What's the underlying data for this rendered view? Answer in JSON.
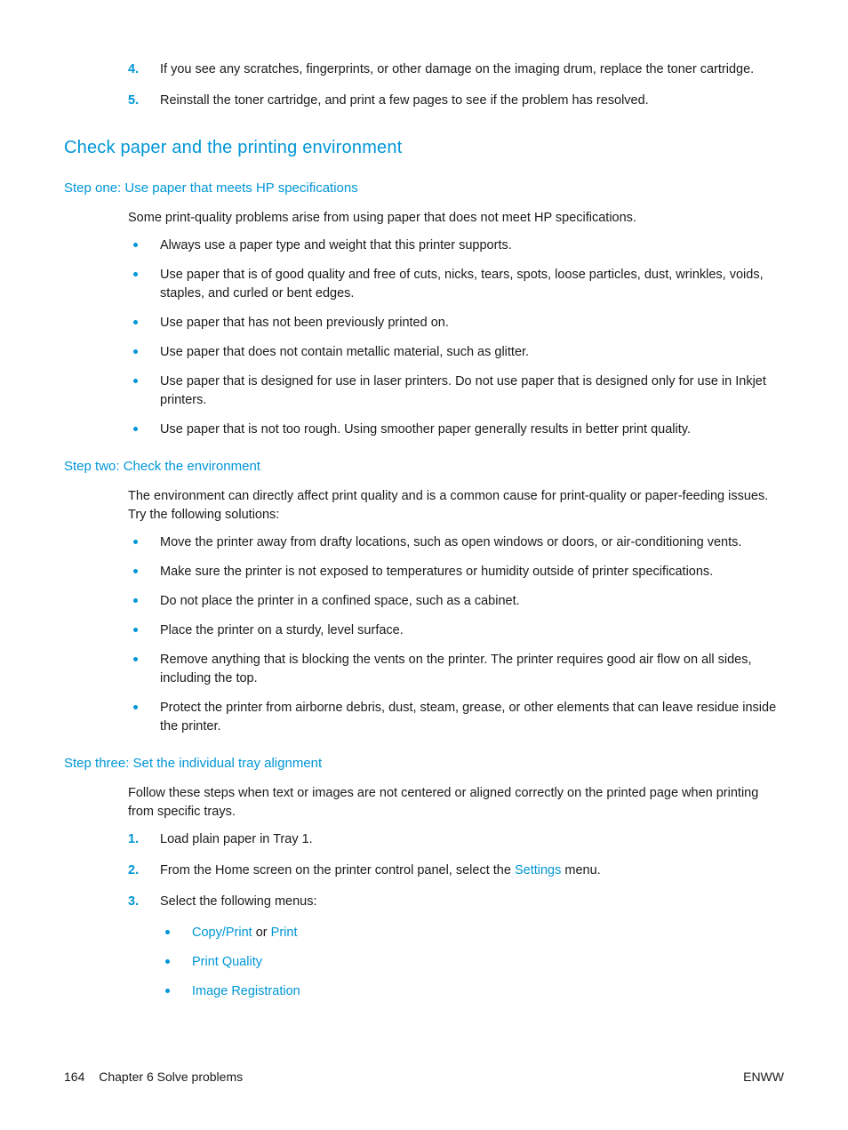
{
  "ordered_top": [
    {
      "n": "4.",
      "text": "If you see any scratches, fingerprints, or other damage on the imaging drum, replace the toner cartridge."
    },
    {
      "n": "5.",
      "text": "Reinstall the toner cartridge, and print a few pages to see if the problem has resolved."
    }
  ],
  "section_heading": "Check paper and the printing environment",
  "step1": {
    "heading": "Step one: Use paper that meets HP specifications",
    "intro": "Some print-quality problems arise from using paper that does not meet HP specifications.",
    "bullets": [
      "Always use a paper type and weight that this printer supports.",
      "Use paper that is of good quality and free of cuts, nicks, tears, spots, loose particles, dust, wrinkles, voids, staples, and curled or bent edges.",
      "Use paper that has not been previously printed on.",
      "Use paper that does not contain metallic material, such as glitter.",
      "Use paper that is designed for use in laser printers. Do not use paper that is designed only for use in Inkjet printers.",
      "Use paper that is not too rough. Using smoother paper generally results in better print quality."
    ]
  },
  "step2": {
    "heading": "Step two: Check the environment",
    "intro": "The environment can directly affect print quality and is a common cause for print-quality or paper-feeding issues. Try the following solutions:",
    "bullets": [
      "Move the printer away from drafty locations, such as open windows or doors, or air-conditioning vents.",
      "Make sure the printer is not exposed to temperatures or humidity outside of printer specifications.",
      "Do not place the printer in a confined space, such as a cabinet.",
      "Place the printer on a sturdy, level surface.",
      "Remove anything that is blocking the vents on the printer. The printer requires good air flow on all sides, including the top.",
      "Protect the printer from airborne debris, dust, steam, grease, or other elements that can leave residue inside the printer."
    ]
  },
  "step3": {
    "heading": "Step three: Set the individual tray alignment",
    "intro": "Follow these steps when text or images are not centered or aligned correctly on the printed page when printing from specific trays.",
    "ordered": [
      {
        "n": "1.",
        "text": "Load plain paper in Tray 1."
      },
      {
        "n": "2.",
        "pre": "From the Home screen on the printer control panel, select the ",
        "term": "Settings",
        "post": " menu."
      },
      {
        "n": "3.",
        "text": "Select the following menus:"
      }
    ],
    "menu_path": {
      "first_a": "Copy/Print",
      "first_sep": " or ",
      "first_b": "Print",
      "second": "Print Quality",
      "third": "Image Registration"
    }
  },
  "footer": {
    "page_number": "164",
    "chapter": "Chapter 6   Solve problems",
    "right": "ENWW"
  }
}
